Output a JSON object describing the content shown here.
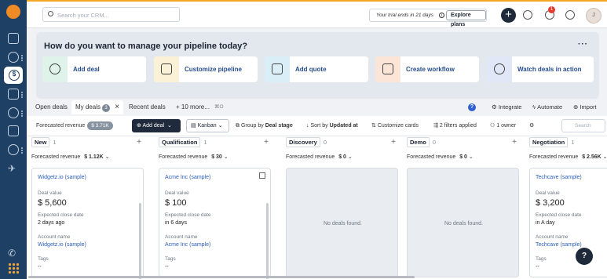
{
  "search": {
    "placeholder": "Search your CRM..."
  },
  "trial": {
    "text": "Your trial ends in 21 days",
    "button": "Explore plans"
  },
  "notifications_count": "1",
  "avatar_initial": "J",
  "pipeline_prompt": {
    "title": "How do you want to manage your pipeline today?",
    "more": "···",
    "cards": [
      {
        "label": "Add deal",
        "icon": "dollar-circle-icon",
        "color": "#dff3ea"
      },
      {
        "label": "Customize pipeline",
        "icon": "document-icon",
        "color": "#fbf1d7"
      },
      {
        "label": "Add quote",
        "icon": "quote-doc-icon",
        "color": "#d9eef6"
      },
      {
        "label": "Create workflow",
        "icon": "workflow-icon",
        "color": "#fbe5d6"
      },
      {
        "label": "Watch deals in action",
        "icon": "play-icon",
        "color": "#e2e7f7"
      }
    ]
  },
  "tabs": {
    "open_deals": "Open deals",
    "my_deals": "My deals",
    "my_deals_count": "3",
    "close": "×",
    "recent": "Recent deals",
    "more": "+ 10 more...",
    "shortcut": "⌘O",
    "integrate": "Integrate",
    "automate": "Automate",
    "import": "Import"
  },
  "toolbar": {
    "forecast_label": "Forecasted revenue",
    "forecast_value": "$ 3.71K",
    "add_deal": "Add deal",
    "view": "Kanban",
    "group_by": "Group by",
    "group_by_value": "Deal stage",
    "sort_by": "Sort by",
    "sort_by_value": "Updated at",
    "customize": "Customize cards",
    "filters": "2 filters applied",
    "owner": "1 owner",
    "search_placeholder": "Search"
  },
  "columns": [
    {
      "name": "New",
      "count": "1",
      "forecast": "$ 1.12K",
      "deal": {
        "title": "Widgetz.io (sample)",
        "value_label": "Deal value",
        "value": "$ 5,600",
        "close_label": "Expected close date",
        "close": "2 days ago",
        "account_label": "Account name",
        "account": "Widgetz.io (sample)",
        "tags_label": "Tags",
        "tags": "--"
      }
    },
    {
      "name": "Qualification",
      "count": "1",
      "forecast": "$ 30",
      "deal": {
        "title": "Acme Inc (sample)",
        "value_label": "Deal value",
        "value": "$ 100",
        "close_label": "Expected close date",
        "close": "in 6 days",
        "account_label": "Account name",
        "account": "Acme Inc (sample)",
        "tags_label": "Tags",
        "tags": "--"
      }
    },
    {
      "name": "Discovery",
      "count": "0",
      "forecast": "$ 0",
      "empty": "No deals found."
    },
    {
      "name": "Demo",
      "count": "0",
      "forecast": "$ 0",
      "empty": "No deals found."
    },
    {
      "name": "Negotiation",
      "count": "1",
      "forecast": "$ 2.56K",
      "deal": {
        "title": "Techcave (sample)",
        "value_label": "Deal value",
        "value": "$ 3,200",
        "close_label": "Expected close date",
        "close": "in A day",
        "account_label": "Account name",
        "account": "Techcave (sample)",
        "tags_label": "Tags",
        "tags": "--"
      }
    }
  ],
  "help_button": "?"
}
